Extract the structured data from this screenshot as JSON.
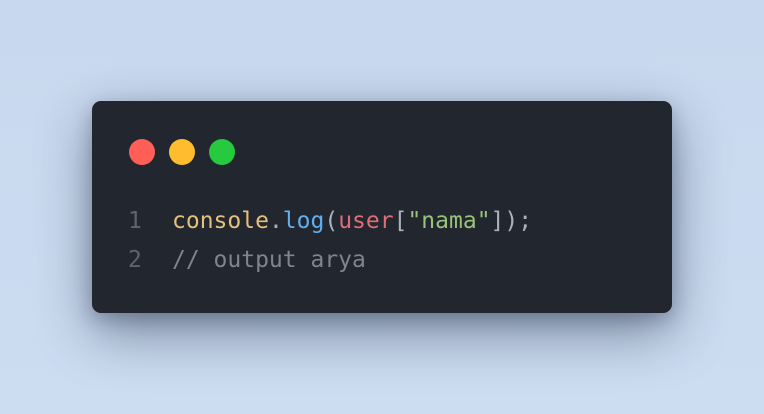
{
  "window": {
    "background": "#22262e",
    "dots": [
      {
        "name": "close-dot",
        "color": "#ff5f56"
      },
      {
        "name": "minimize-dot",
        "color": "#ffbd2e"
      },
      {
        "name": "maximize-dot",
        "color": "#27c93f"
      }
    ]
  },
  "code": {
    "lines": [
      {
        "number": "1",
        "tokens": [
          {
            "text": "console",
            "color": "#e5c07b"
          },
          {
            "text": ".",
            "color": "#abb2bf"
          },
          {
            "text": "log",
            "color": "#61afef"
          },
          {
            "text": "(",
            "color": "#abb2bf"
          },
          {
            "text": "user",
            "color": "#e06c75"
          },
          {
            "text": "[",
            "color": "#abb2bf"
          },
          {
            "text": "\"nama\"",
            "color": "#98c379"
          },
          {
            "text": "]);",
            "color": "#abb2bf"
          }
        ]
      },
      {
        "number": "2",
        "tokens": [
          {
            "text": "// output arya",
            "color": "#7f848e"
          }
        ]
      }
    ]
  }
}
